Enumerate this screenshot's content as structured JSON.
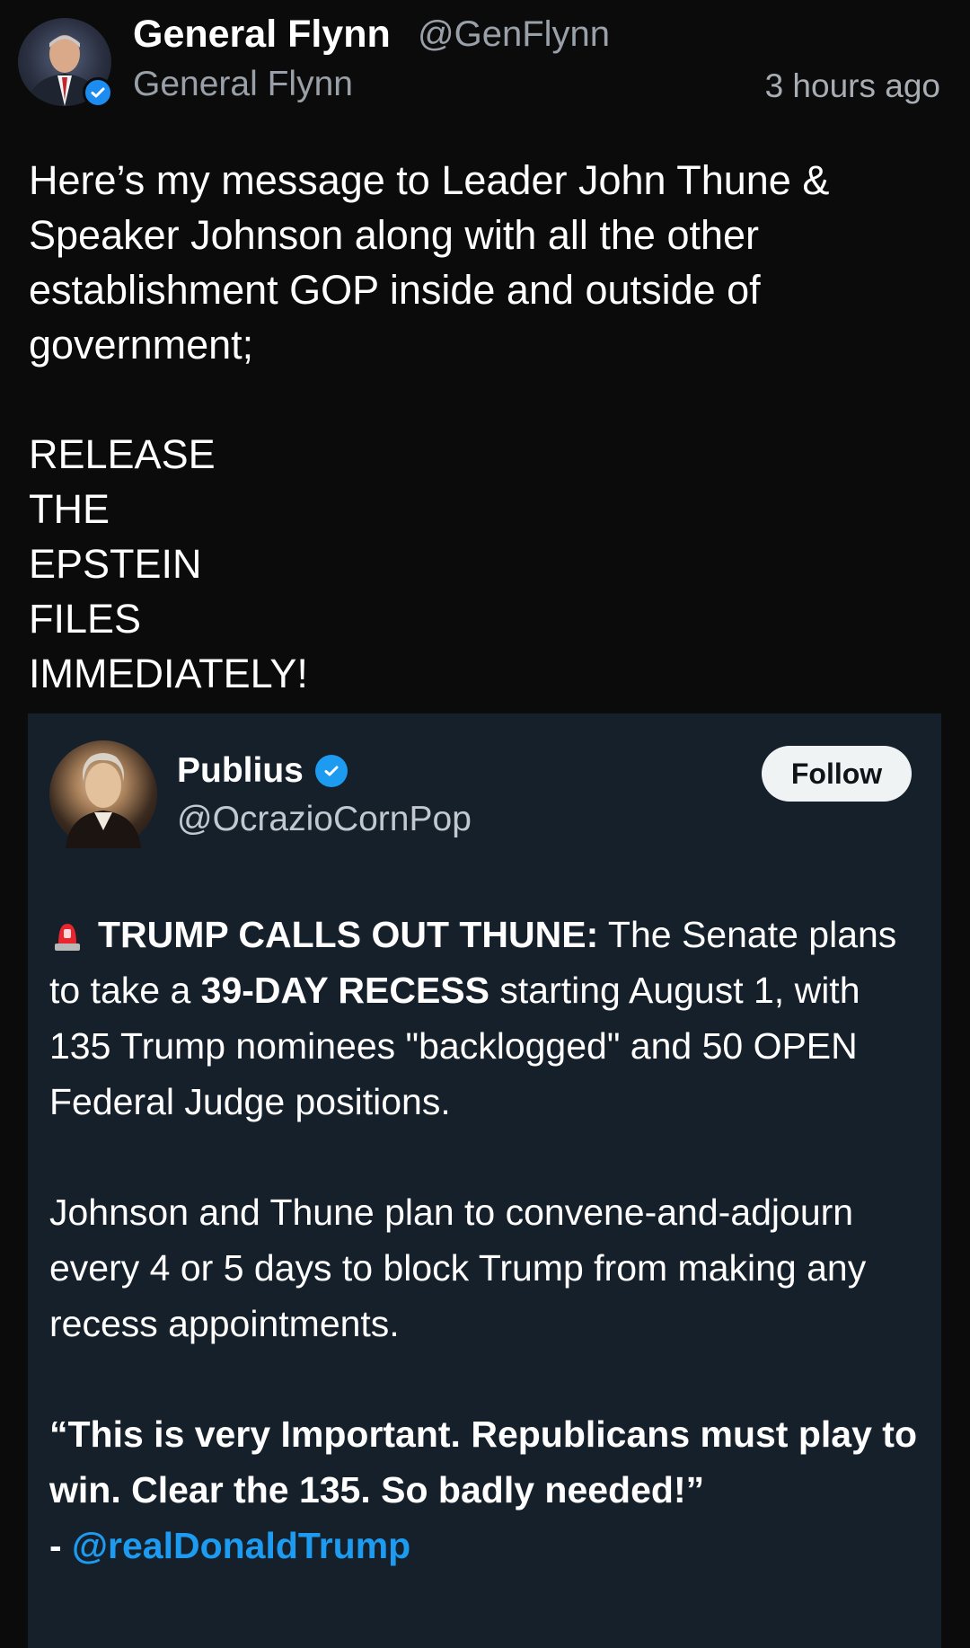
{
  "post": {
    "display_name": "General Flynn",
    "handle": "@GenFlynn",
    "sub_name": "General Flynn",
    "timestamp": "3 hours ago",
    "avatar_icon": "profile-photo",
    "verified_icon": "verified-badge-icon",
    "body_lines": [
      "Here’s my message to Leader John Thune &",
      "Speaker Johnson along with all the other",
      "establishment GOP inside and outside of",
      "government;"
    ],
    "shout_lines": [
      "RELEASE",
      "THE",
      "EPSTEIN",
      "FILES",
      "IMMEDIATELY!"
    ]
  },
  "quote": {
    "name": "Publius",
    "handle": "@OcrazioCornPop",
    "follow_label": "Follow",
    "siren_icon": "rotating-light-icon",
    "p1": {
      "headline": "TRUMP CALLS OUT THUNE:",
      "t1": " The Senate plans to take a ",
      "bold2": "39-DAY RECESS",
      "t2": " starting August 1, with 135 Trump nominees \"backlogged\" and 50 OPEN Federal Judge positions."
    },
    "p2": "Johnson and Thune plan to convene-and-adjourn every 4 or 5 days to block Trump from making any recess appointments.",
    "p3": "“This is very Important. Republicans must play to win. Clear the 135. So badly needed!”",
    "p3_dash": "- ",
    "mention": "@realDonaldTrump"
  },
  "colors": {
    "background": "#0b0b0c",
    "card": "#15202b",
    "verified": "#1d9bf0",
    "mention": "#1d9bf0"
  }
}
